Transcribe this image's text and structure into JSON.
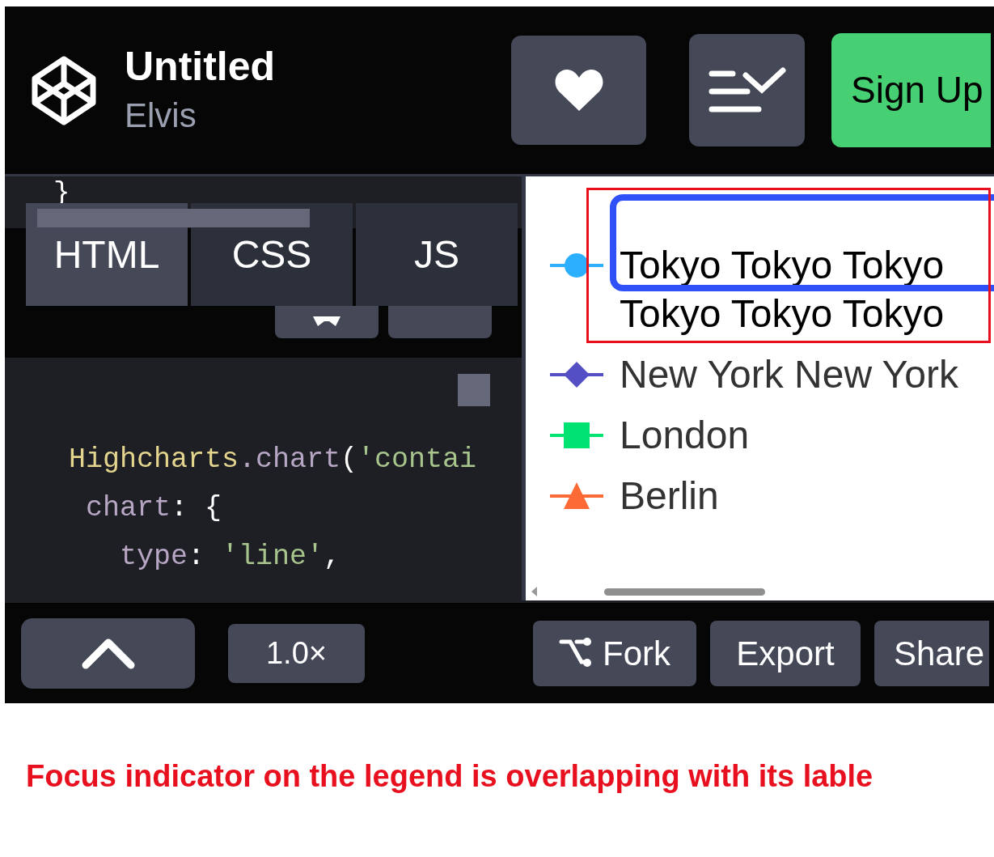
{
  "header": {
    "title": "Untitled",
    "author": "Elvis",
    "buttons": [
      {
        "kind": "heart"
      },
      {
        "kind": "menu"
      },
      {
        "kind": "signup",
        "label": "Sign Up"
      }
    ]
  },
  "editor": {
    "tabs": [
      {
        "label": "HTML",
        "selected": true
      },
      {
        "label": "CSS",
        "selected": false
      },
      {
        "label": "JS",
        "selected": false
      }
    ],
    "code_above": "}",
    "code": [
      [
        {
          "text": "Highcharts",
          "kind": "ident"
        },
        {
          "text": ".chart",
          "kind": "prop"
        },
        {
          "text": "(",
          "kind": "punct"
        },
        {
          "text": "'contai",
          "kind": "string"
        }
      ],
      [
        {
          "text": " chart",
          "kind": "prop"
        },
        {
          "text": ": {",
          "kind": "punct"
        }
      ],
      [
        {
          "text": "   type",
          "kind": "prop"
        },
        {
          "text": ": ",
          "kind": "punct"
        },
        {
          "text": "'line'",
          "kind": "string"
        },
        {
          "text": ",",
          "kind": "punct"
        }
      ]
    ]
  },
  "preview": {
    "legend": [
      {
        "lines": [
          "Tokyo Tokyo Tokyo",
          "Tokyo Tokyo Tokyo"
        ],
        "kind": "circle",
        "color": "#2caffe",
        "focused": true
      },
      {
        "lines": [
          "New York New York"
        ],
        "kind": "diamond",
        "color": "#544fc5",
        "focused": false
      },
      {
        "lines": [
          "London"
        ],
        "kind": "square",
        "color": "#00e272",
        "focused": false
      },
      {
        "lines": [
          "Berlin"
        ],
        "kind": "triangle",
        "color": "#fe6a35",
        "focused": false
      }
    ]
  },
  "footer": {
    "buttons": [
      {
        "kind": "collapse"
      },
      {
        "kind": "zoom",
        "label": "1.0×"
      },
      {
        "kind": "fork",
        "label": "Fork"
      },
      {
        "kind": "export",
        "label": "Export"
      },
      {
        "kind": "share",
        "label": "Share"
      }
    ]
  },
  "annotation": {
    "highlight": true,
    "caption": "Focus indicator on the legend is overlapping with its lable"
  }
}
